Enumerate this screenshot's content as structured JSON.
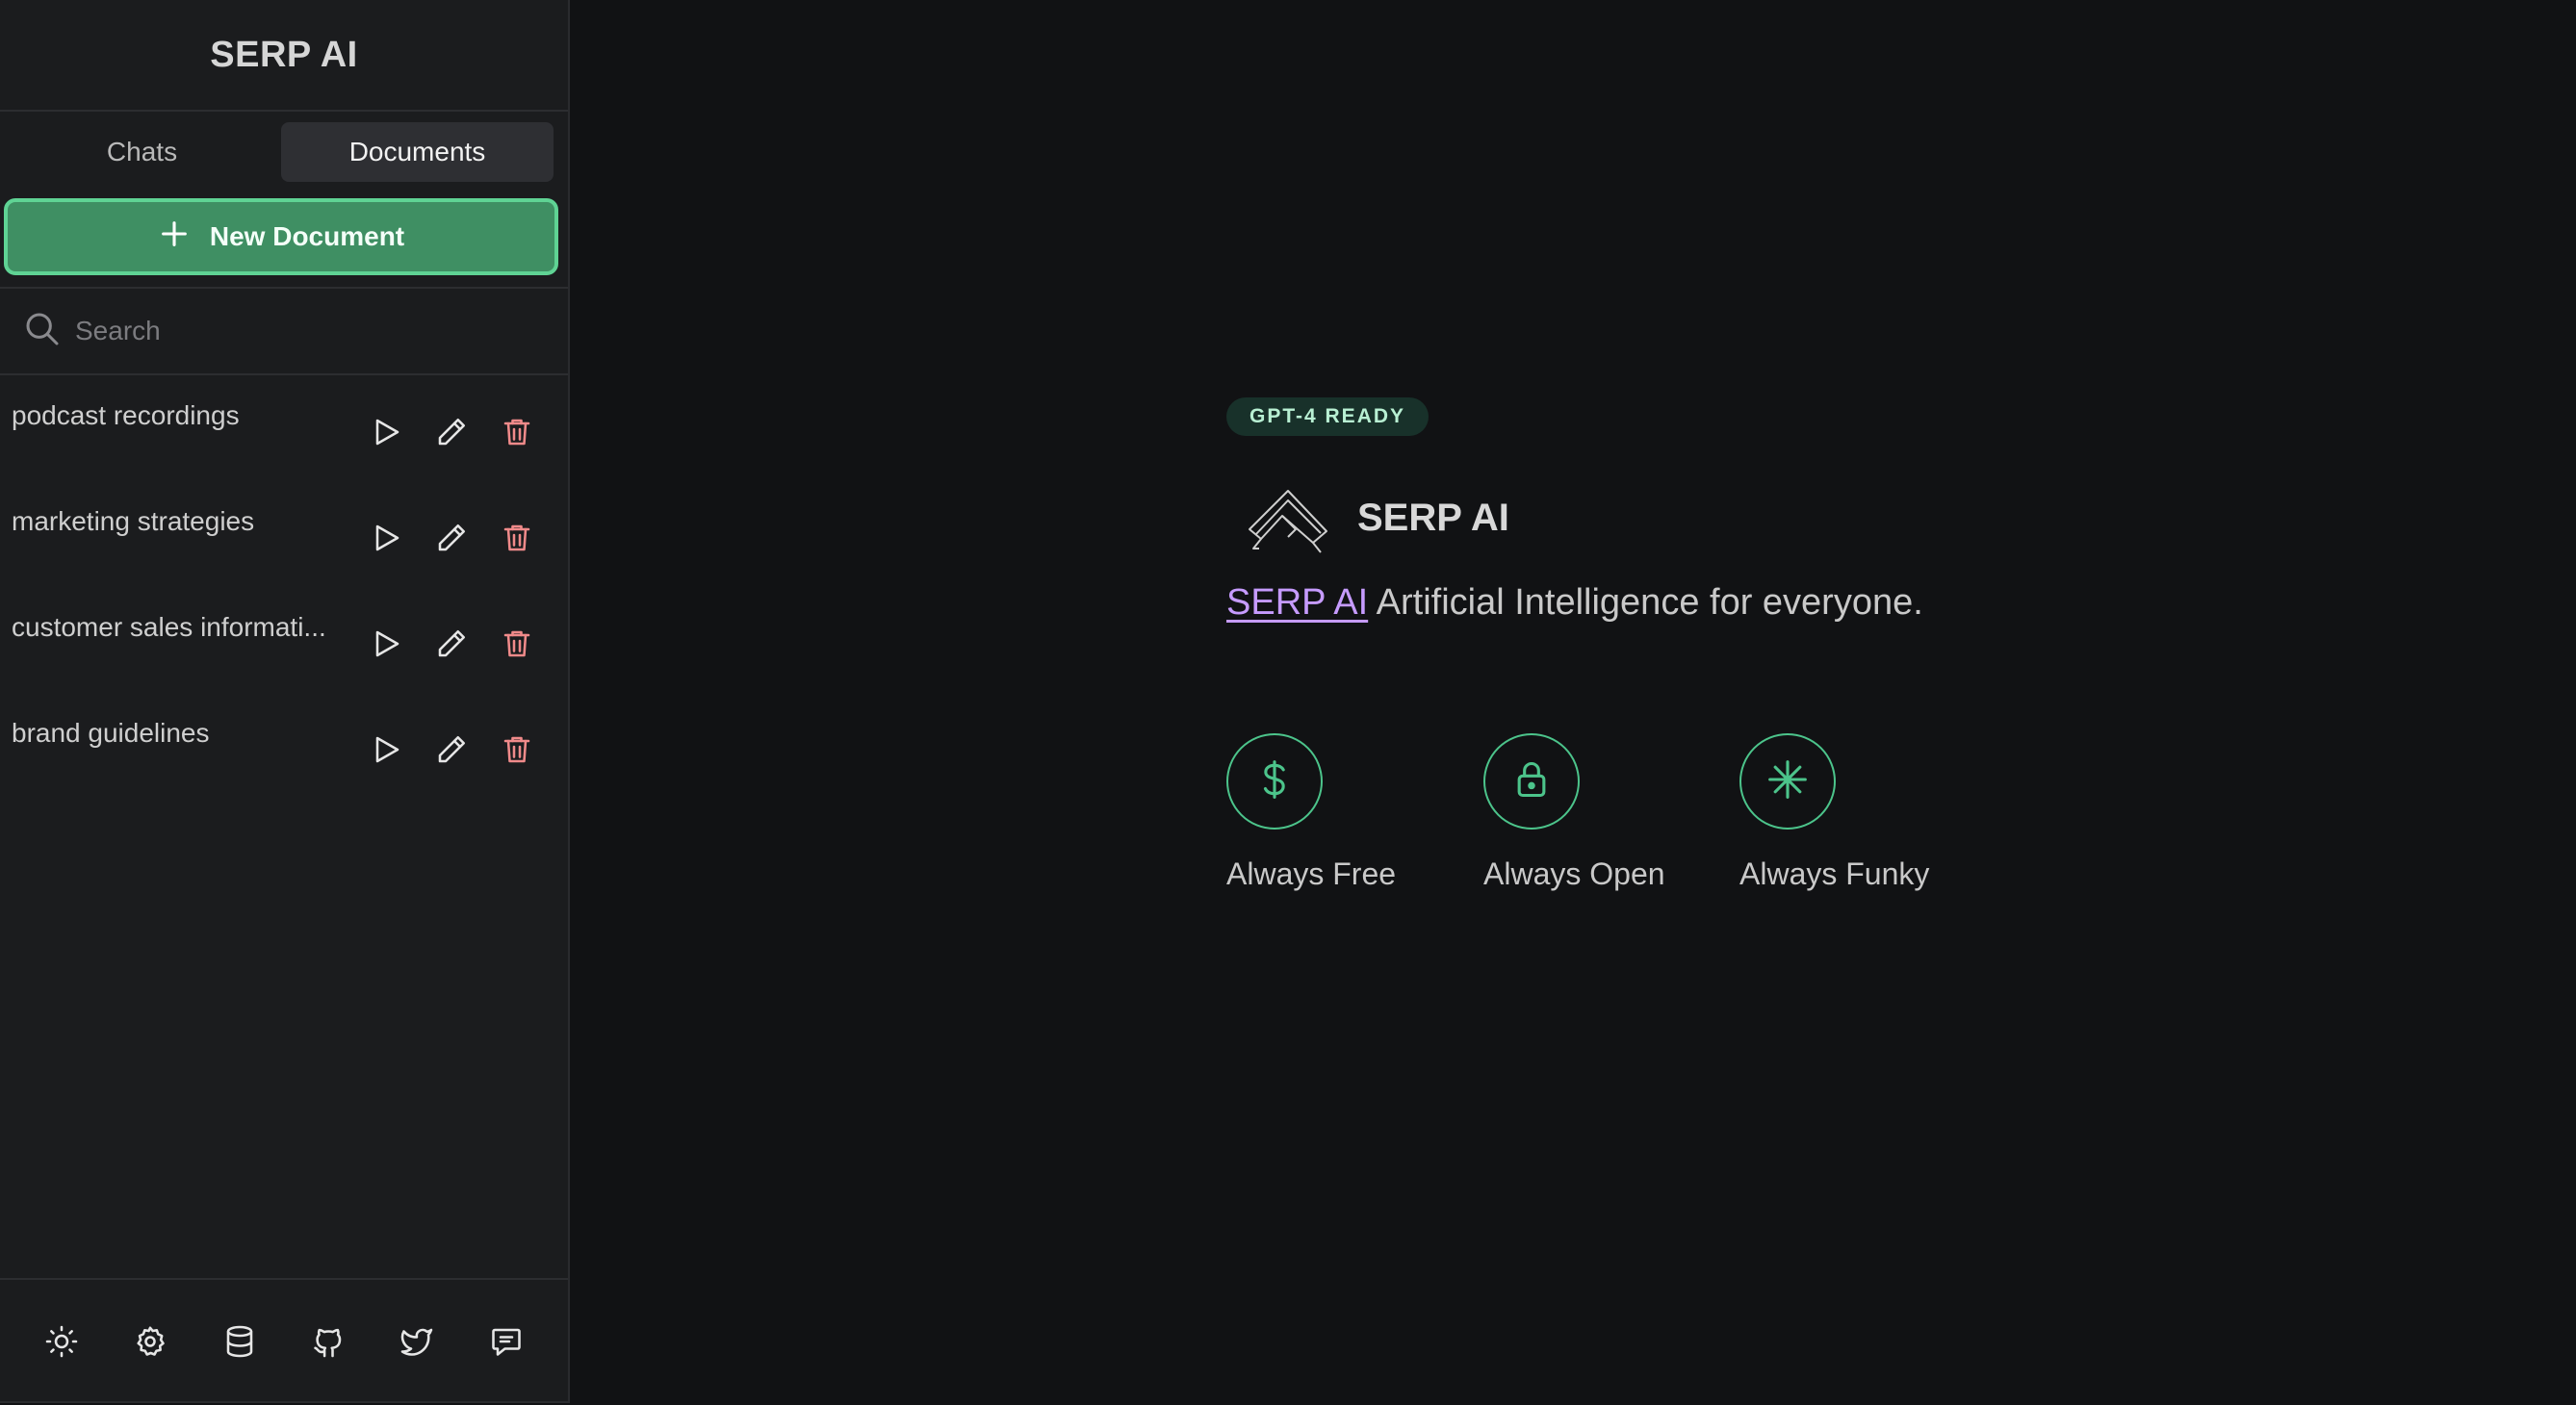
{
  "sidebar": {
    "brand": "SERP AI",
    "tabs": [
      {
        "label": "Chats",
        "active": false
      },
      {
        "label": "Documents",
        "active": true
      }
    ],
    "new_document_label": "New Document",
    "search_placeholder": "Search",
    "documents": [
      {
        "name": "podcast recordings"
      },
      {
        "name": "marketing strategies"
      },
      {
        "name": "customer sales informati..."
      },
      {
        "name": "brand guidelines"
      }
    ],
    "item_actions": [
      "play-icon",
      "pencil-icon",
      "trash-icon"
    ],
    "footer_icons": [
      "sun-icon",
      "gear-icon",
      "database-icon",
      "github-icon",
      "twitter-icon",
      "chat-bubble-icon"
    ]
  },
  "main": {
    "badge": "GPT-4 READY",
    "title": "SERP AI",
    "tagline_link": "SERP AI",
    "tagline_rest": " Artificial Intelligence for everyone.",
    "features": [
      {
        "label": "Always Free",
        "icon": "dollar-icon"
      },
      {
        "label": "Always Open",
        "icon": "lock-icon"
      },
      {
        "label": "Always Funky",
        "icon": "asterisk-icon"
      }
    ]
  },
  "colors": {
    "background": "#111214",
    "sidebar": "#1b1c1e",
    "accent_green": "#3f8f63",
    "accent_green_border": "#5fd394",
    "delete_red": "#f08a8a",
    "link_purple": "#c69bff",
    "feature_green": "#4cc48b"
  }
}
